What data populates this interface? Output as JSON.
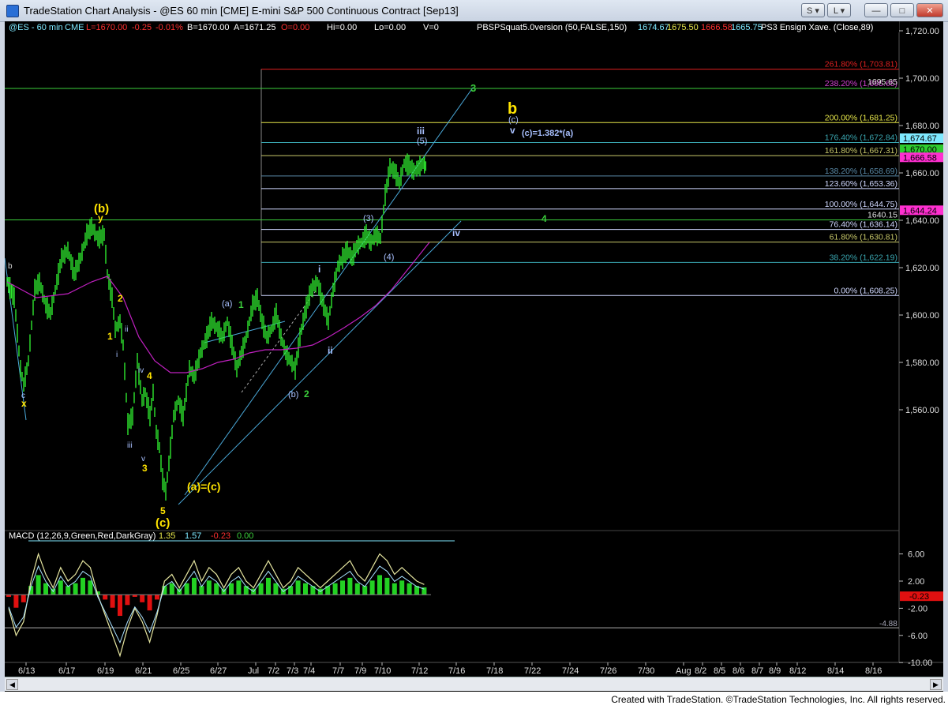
{
  "window": {
    "title": "TradeStation Chart Analysis - @ES 60 min [CME] E-mini S&P 500 Continuous Contract [Sep13]",
    "buttons": [
      "S",
      "L",
      "—",
      "□",
      "✕"
    ]
  },
  "header": {
    "symbol": "@ES - 60 min",
    "exchange": "CME",
    "last": "L=1670.00",
    "change": "-0.25",
    "pct_change": "-0.01%",
    "bid": "B=1670.00",
    "ask": "A=1671.25",
    "open": "O=0.00",
    "high": "Hi=0.00",
    "low": "Lo=0.00",
    "volume": "V=0",
    "indicator1_name": "PBSPSquat5.0version (50,FALSE,150)",
    "indicator1_values": [
      "1674.67",
      "1675.50",
      "1666.58",
      "1665.75"
    ],
    "indicator2_name": "PS3 Ensign Xave. (Close,89)"
  },
  "price_axis": {
    "ticks": [
      "1,720.00",
      "1,700.00",
      "1,680.00",
      "1,660.00",
      "1,640.00",
      "1,620.00",
      "1,600.00",
      "1,580.00",
      "1,560.00"
    ],
    "badges": [
      {
        "label": "1,674.67",
        "color": "#7fe9ff"
      },
      {
        "label": "1,670.00",
        "color": "#2ecc2e"
      },
      {
        "label": "1,666.58",
        "color": "#ff2fd0"
      },
      {
        "label": "1,644.24",
        "color": "#ff2fd0"
      }
    ]
  },
  "fib_levels": [
    {
      "label": "261.80% (1,703.81)",
      "color": "#e02020"
    },
    {
      "label": "238.20% (1,695.65)",
      "color": "#d040d0"
    },
    {
      "label": "200.00% (1,681.25)",
      "color": "#e6e64a"
    },
    {
      "label": "176.40% (1,672.84)",
      "color": "#3aa6b0"
    },
    {
      "label": "161.80% (1,667.31)",
      "color": "#c8c86a"
    },
    {
      "label": "138.20% (1,658.69)",
      "color": "#5a8aa8"
    },
    {
      "label": "123.60% (1,653.36)",
      "color": "#d0d8ff"
    },
    {
      "label": "100.00% (1,644.75)",
      "color": "#d0d8ff"
    },
    {
      "label": "76.40% (1,636.14)",
      "color": "#d0d8ff"
    },
    {
      "label": "61.80% (1,630.81)",
      "color": "#c8c86a"
    },
    {
      "label": "38.20% (1,622.19)",
      "color": "#3aa6b0"
    },
    {
      "label": "0.00% (1,608.25)",
      "color": "#d0d8ff"
    }
  ],
  "level_labels": [
    "1695.65",
    "1640.15"
  ],
  "wave_labels": {
    "b_small": "b",
    "c_x": "c",
    "x": "x",
    "b_paren": "(b)",
    "y": "y",
    "n2": "2",
    "n1": "1",
    "ii_small": "ii",
    "i_small": "i",
    "iv_small": "iv",
    "n4": "4",
    "iii_small": "iii",
    "v_small": "v",
    "n3": "3",
    "n5": "5",
    "c_paren": "(c)",
    "a_eq_c": "(a)=(c)",
    "a_paren": "(a)",
    "g1": "1",
    "b_paren2": "(b)",
    "g2": "2",
    "i_roman": "i",
    "ii_roman": "ii",
    "p3": "(3)",
    "p4": "(4)",
    "p5": "(5)",
    "iii_roman": "iii",
    "g3": "3",
    "big_b": "b",
    "c_small": "(c)",
    "v_roman": "v",
    "c_ratio": "(c)=1.382*(a)",
    "g4": "4",
    "iv_roman": "iv"
  },
  "macd": {
    "label": "MACD (12,26,9,Green,Red,DarkGray)",
    "values": [
      "1.35",
      "1.57",
      "-0.23",
      "0.00"
    ],
    "ticks": [
      "6.00",
      "2.00",
      "-2.00",
      "-6.00",
      "-10.00"
    ],
    "badge": "-0.23",
    "ref_label": "-4.88"
  },
  "time_axis": [
    "6/13",
    "6/17",
    "6/19",
    "6/21",
    "6/25",
    "6/27",
    "Jul",
    "7/2",
    "7/3",
    "7/4",
    "7/7",
    "7/9",
    "7/10",
    "7/12",
    "7/16",
    "7/18",
    "7/22",
    "7/24",
    "7/26",
    "7/30",
    "Aug",
    "8/2",
    "8/5",
    "8/6",
    "8/7",
    "8/9",
    "8/12",
    "8/14",
    "8/16"
  ],
  "footer": "Created with TradeStation. ©TradeStation Technologies, Inc. All rights reserved.",
  "colors": {
    "background": "#000000",
    "price_bars": "#2ee82e",
    "moving_average": "#c020c0",
    "channel": "#4aa8d8",
    "wave_yellow": "#ffe400",
    "wave_green": "#3ccf3c",
    "wave_blue": "#a8c0ff"
  }
}
